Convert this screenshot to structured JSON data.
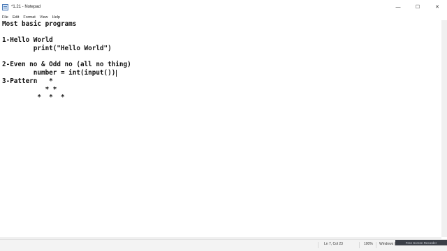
{
  "window": {
    "title": "*1.21 - Notepad",
    "controls": {
      "minimize": "—",
      "maximize": "☐",
      "close": "✕"
    }
  },
  "menu": {
    "items": [
      "File",
      "Edit",
      "Format",
      "View",
      "Help"
    ]
  },
  "editor": {
    "lines": [
      "Most basic programs",
      "",
      "1-Hello World",
      "        print(\"Hello World\")",
      "",
      "2-Even no & Odd no (all no thing)",
      "        number = int(input())",
      "3-Pattern   *",
      "           * *",
      "         *  *  *"
    ]
  },
  "status": {
    "position": "Ln 7, Col 23",
    "zoom": "100%",
    "line_ending": "Windows (CRLF)",
    "watermark": "Free Screen Recorder"
  },
  "icons": {
    "app": "notepad-icon"
  }
}
